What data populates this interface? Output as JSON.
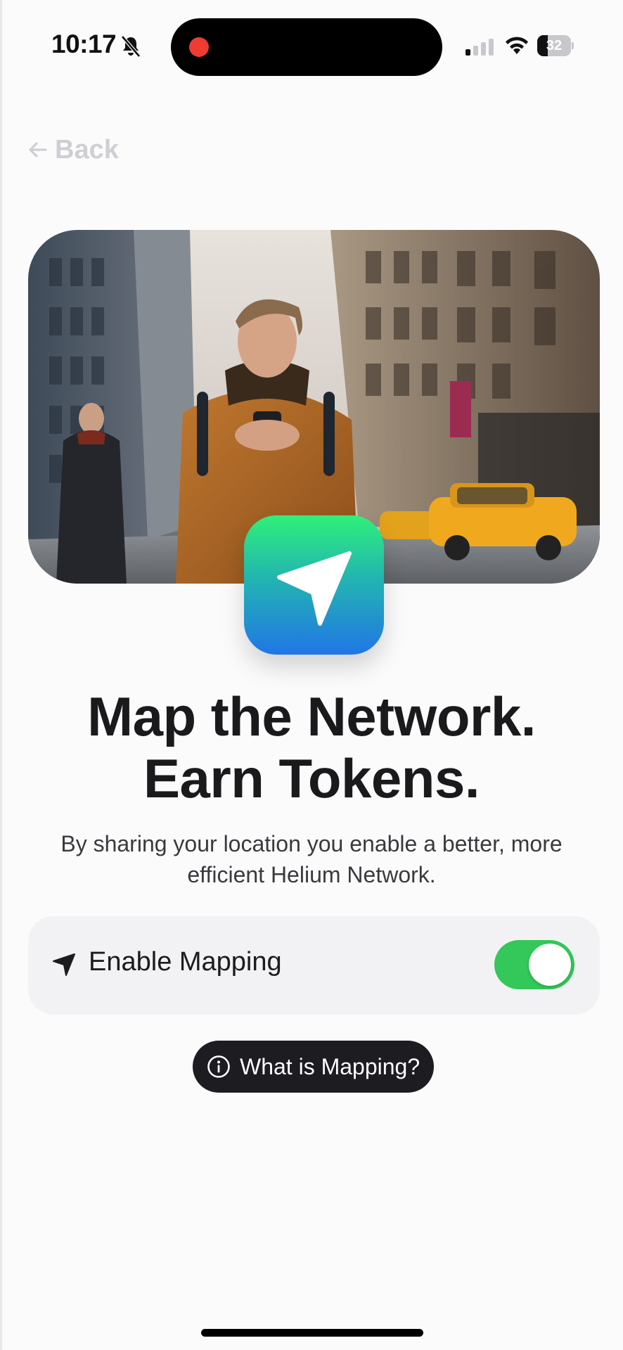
{
  "status_bar": {
    "time": "10:17",
    "battery_level": "32",
    "battery_fraction": 0.32,
    "icons": [
      "bell-slash-icon",
      "signal-icon",
      "wifi-icon",
      "battery-icon"
    ],
    "recording_color": "#ee3c33"
  },
  "nav": {
    "back_label": "Back",
    "back_icon": "arrow-left-icon"
  },
  "hero": {
    "image": "city-street-man-with-phone-photo"
  },
  "app_badge": {
    "icon": "location-arrow-icon",
    "gradient": [
      "#2ff07a",
      "#2176e6"
    ]
  },
  "headline": {
    "line1": "Map the Network.",
    "line2": "Earn Tokens."
  },
  "subtitle": {
    "line1": "By sharing your location you enable a better, more",
    "line2": "efficient Helium Network."
  },
  "mapping": {
    "icon": "location-arrow-icon",
    "label": "Enable Mapping",
    "enabled": true,
    "toggle_color": "#34c759"
  },
  "info_button": {
    "icon": "info-circle-icon",
    "label": "What is Mapping?"
  }
}
